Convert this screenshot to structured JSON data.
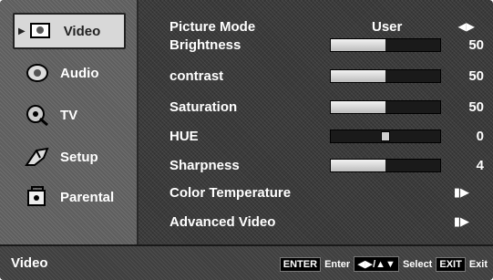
{
  "sidebar": {
    "items": [
      {
        "label": "Video",
        "icon": "video-icon",
        "active": true
      },
      {
        "label": "Audio",
        "icon": "audio-icon",
        "active": false
      },
      {
        "label": "TV",
        "icon": "tv-icon",
        "active": false
      },
      {
        "label": "Setup",
        "icon": "setup-icon",
        "active": false
      },
      {
        "label": "Parental",
        "icon": "parental-icon",
        "active": false
      }
    ]
  },
  "menu": {
    "picture_mode": {
      "label": "Picture Mode",
      "value": "User"
    },
    "brightness": {
      "label": "Brightness",
      "value": "50",
      "level": 0.5
    },
    "contrast": {
      "label": "contrast",
      "value": "50",
      "level": 0.5
    },
    "saturation": {
      "label": "Saturation",
      "value": "50",
      "level": 0.5
    },
    "hue": {
      "label": "HUE",
      "value": "0",
      "level": 0.5
    },
    "sharpness": {
      "label": "Sharpness",
      "value": "4",
      "level": 0.5
    },
    "color_temperature": {
      "label": "Color Temperature"
    },
    "advanced_video": {
      "label": "Advanced Video"
    }
  },
  "status": {
    "title": "Video",
    "enter_key": "ENTER",
    "enter_label": "Enter",
    "select_label": "Select",
    "exit_key": "EXIT",
    "exit_label": "Exit"
  }
}
